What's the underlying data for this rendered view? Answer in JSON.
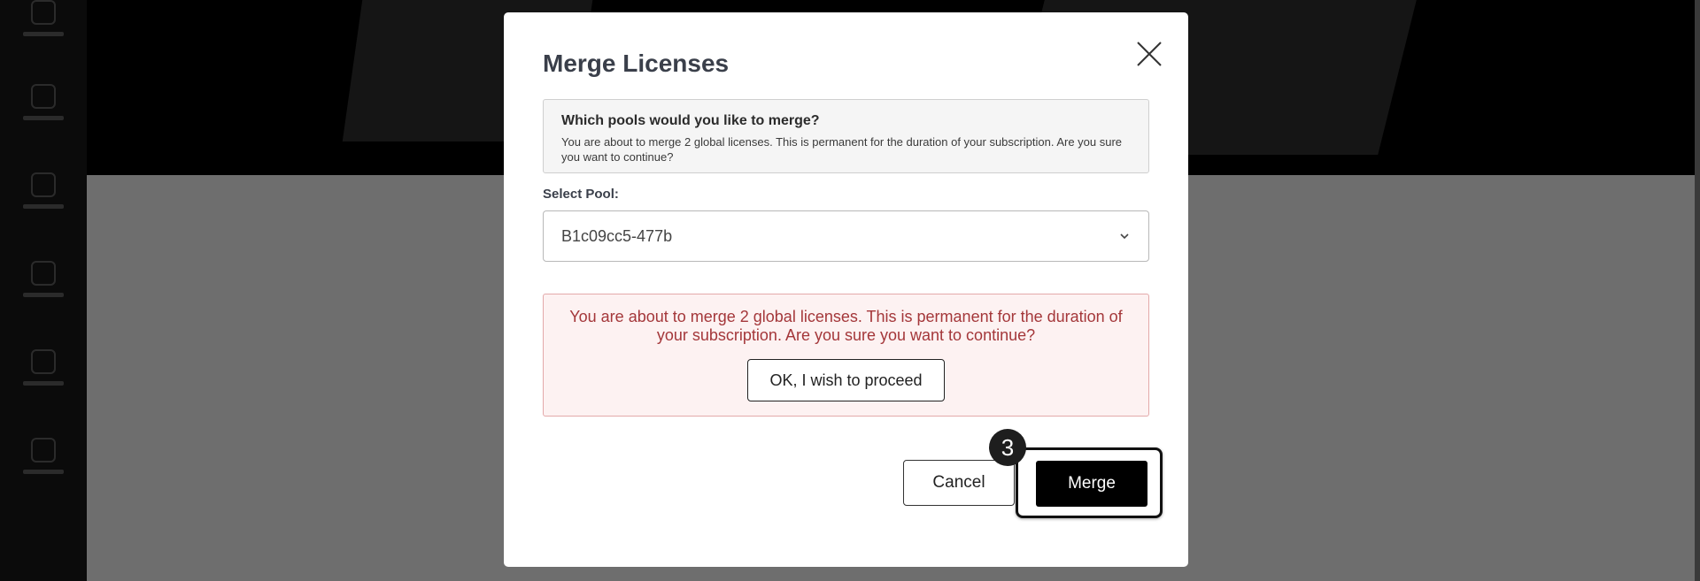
{
  "modal": {
    "title": "Merge Licenses",
    "info": {
      "title": "Which pools would you like to merge?",
      "text": "You are about to merge 2 global licenses. This is permanent for the duration of your subscription. Are you sure you want to continue?"
    },
    "select": {
      "label": "Select Pool:",
      "value": "B1c09cc5-477b"
    },
    "warning": {
      "text": "You are about to merge 2 global licenses. This is permanent for the duration of your subscription. Are you sure you want to continue?",
      "proceed_label": "OK, I wish to proceed"
    },
    "actions": {
      "cancel_label": "Cancel",
      "merge_label": "Merge"
    },
    "step_badge": "3"
  },
  "icons": {
    "close": "close-icon",
    "dropdown": "chevron-down-icon"
  },
  "colors": {
    "warning_text": "#a4373a",
    "warning_bg": "#fdf2f2",
    "primary_button": "#000000"
  }
}
